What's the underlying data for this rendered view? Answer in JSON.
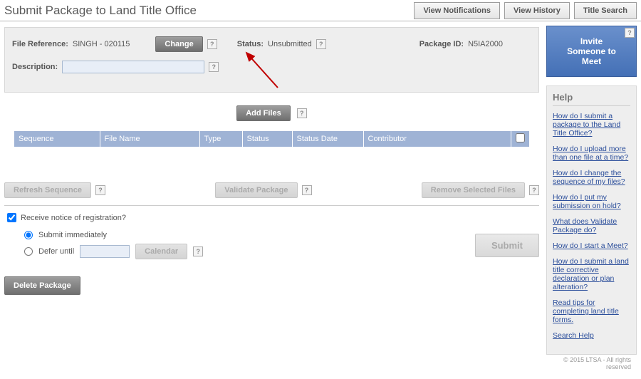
{
  "header": {
    "title": "Submit Package to Land Title Office",
    "buttons": {
      "notifications": "View Notifications",
      "history": "View History",
      "title_search": "Title Search"
    }
  },
  "info": {
    "file_ref_label": "File Reference:",
    "file_ref_value": "SINGH - 020115",
    "change_btn": "Change",
    "status_label": "Status:",
    "status_value": "Unsubmitted",
    "package_id_label": "Package ID:",
    "package_id_value": "N5IA2000",
    "description_label": "Description:",
    "description_value": ""
  },
  "add_files_btn": "Add Files",
  "table": {
    "cols": {
      "sequence": "Sequence",
      "file_name": "File Name",
      "type": "Type",
      "status": "Status",
      "status_date": "Status Date",
      "contributor": "Contributor"
    }
  },
  "actions": {
    "refresh": "Refresh Sequence",
    "validate": "Validate Package",
    "remove": "Remove Selected Files"
  },
  "options": {
    "receive_notice": "Receive notice of registration?",
    "submit_immediately": "Submit immediately",
    "defer_until": "Defer until",
    "calendar": "Calendar",
    "defer_date": ""
  },
  "submit_btn": "Submit",
  "delete_btn": "Delete Package",
  "invite": {
    "line1": "Invite",
    "line2": "Someone to",
    "line3": "Meet"
  },
  "help": {
    "title": "Help",
    "links": [
      "How do I submit a package to the Land Title Office?",
      "How do I upload more than one file at a time?",
      "How do I change the sequence of my files?",
      "How do I put my submission on hold?",
      "What does Validate Package do?",
      "How do I start a Meet?",
      "How do I submit a land title corrective declaration or plan alteration?",
      "Read tips for completing land title forms.",
      "Search Help"
    ]
  },
  "footer": "© 2015 LTSA - All rights reserved"
}
